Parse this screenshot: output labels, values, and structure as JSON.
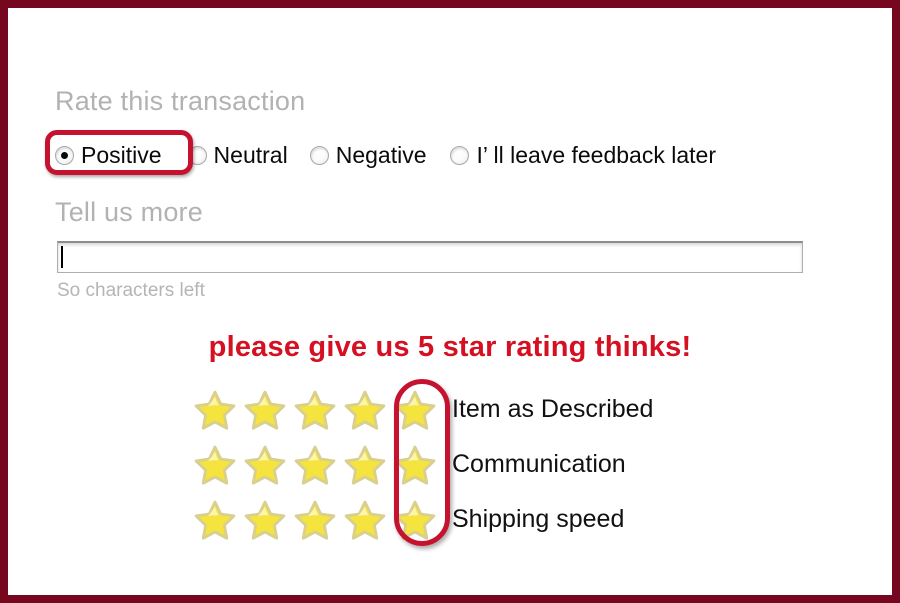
{
  "frame": {
    "border_color": "#76071f",
    "background": "#ffffff"
  },
  "rate_section": {
    "heading": "Rate this transaction",
    "options": [
      {
        "label": "Positive",
        "checked": true,
        "highlighted": true
      },
      {
        "label": "Neutral",
        "checked": false,
        "highlighted": false
      },
      {
        "label": "Negative",
        "checked": false,
        "highlighted": false
      },
      {
        "label": "I’  ll leave feedback later",
        "checked": false,
        "highlighted": false
      }
    ]
  },
  "tell_us_more": {
    "heading": "Tell us more",
    "input_value": "",
    "input_placeholder": "",
    "chars_left": "So characters left"
  },
  "promo": {
    "text": "please give us 5 star rating thinks!",
    "color": "#d41022"
  },
  "ratings": {
    "star_count": 5,
    "highlight_column": 5,
    "highlight_color": "#c4122f",
    "star_fill": "#f5e43e",
    "star_stroke": "#d9cf8f",
    "rows": [
      {
        "label": "Item as Described",
        "stars": 5
      },
      {
        "label": "Communication",
        "stars": 5
      },
      {
        "label": "Shipping speed",
        "stars": 5
      }
    ]
  }
}
